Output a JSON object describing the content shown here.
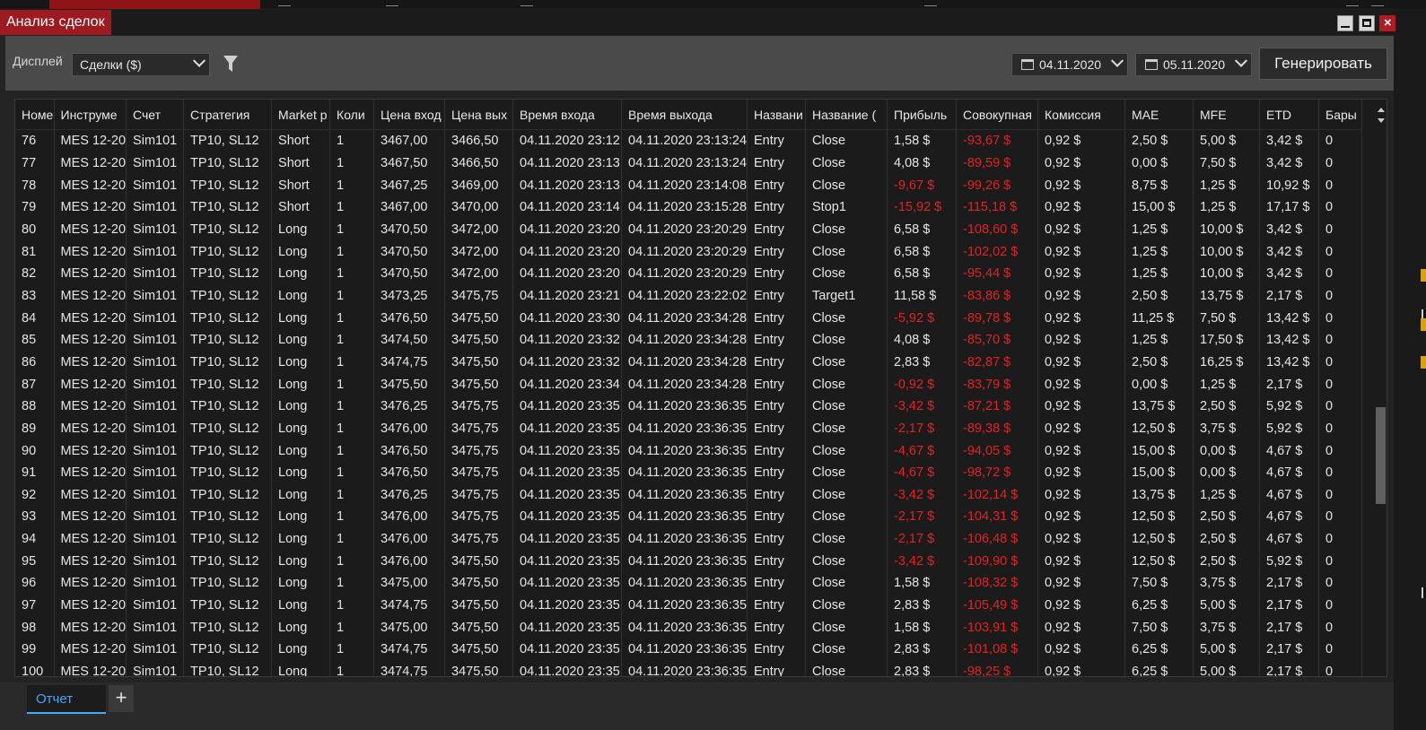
{
  "window": {
    "title": "Анализ сделок"
  },
  "toolbar": {
    "display_label": "Дисплей",
    "display_value": "Сделки ($)",
    "date_from": "04.11.2020",
    "date_to": "05.11.2020",
    "generate_label": "Генерировать"
  },
  "table": {
    "columns": [
      "Номе",
      "Инструме",
      "Счет",
      "Стратегия",
      "Market p",
      "Коли",
      "Цена вход",
      "Цена вых",
      "Время входа",
      "Время выхода",
      "Названи",
      "Название (",
      "Прибыль",
      "Совокупная",
      "Комиссия",
      "MAE",
      "MFE",
      "ETD",
      "Бары"
    ],
    "rows": [
      [
        "76",
        "MES 12-20",
        "Sim101",
        "TP10, SL12",
        "Short",
        "1",
        "3467,00",
        "3466,50",
        "04.11.2020 23:12",
        "04.11.2020 23:13:24",
        "Entry",
        "Close",
        "1,58 $",
        "-93,67 $",
        "0,92 $",
        "2,50 $",
        "5,00 $",
        "3,42 $",
        "0"
      ],
      [
        "77",
        "MES 12-20",
        "Sim101",
        "TP10, SL12",
        "Short",
        "1",
        "3467,50",
        "3466,50",
        "04.11.2020 23:13",
        "04.11.2020 23:13:24",
        "Entry",
        "Close",
        "4,08 $",
        "-89,59 $",
        "0,92 $",
        "0,00 $",
        "7,50 $",
        "3,42 $",
        "0"
      ],
      [
        "78",
        "MES 12-20",
        "Sim101",
        "TP10, SL12",
        "Short",
        "1",
        "3467,25",
        "3469,00",
        "04.11.2020 23:13",
        "04.11.2020 23:14:08",
        "Entry",
        "Close",
        "-9,67 $",
        "-99,26 $",
        "0,92 $",
        "8,75 $",
        "1,25 $",
        "10,92 $",
        "0"
      ],
      [
        "79",
        "MES 12-20",
        "Sim101",
        "TP10, SL12",
        "Short",
        "1",
        "3467,00",
        "3470,00",
        "04.11.2020 23:14",
        "04.11.2020 23:15:28",
        "Entry",
        "Stop1",
        "-15,92 $",
        "-115,18 $",
        "0,92 $",
        "15,00 $",
        "1,25 $",
        "17,17 $",
        "0"
      ],
      [
        "80",
        "MES 12-20",
        "Sim101",
        "TP10, SL12",
        "Long",
        "1",
        "3470,50",
        "3472,00",
        "04.11.2020 23:20",
        "04.11.2020 23:20:29",
        "Entry",
        "Close",
        "6,58 $",
        "-108,60 $",
        "0,92 $",
        "1,25 $",
        "10,00 $",
        "3,42 $",
        "0"
      ],
      [
        "81",
        "MES 12-20",
        "Sim101",
        "TP10, SL12",
        "Long",
        "1",
        "3470,50",
        "3472,00",
        "04.11.2020 23:20",
        "04.11.2020 23:20:29",
        "Entry",
        "Close",
        "6,58 $",
        "-102,02 $",
        "0,92 $",
        "1,25 $",
        "10,00 $",
        "3,42 $",
        "0"
      ],
      [
        "82",
        "MES 12-20",
        "Sim101",
        "TP10, SL12",
        "Long",
        "1",
        "3470,50",
        "3472,00",
        "04.11.2020 23:20",
        "04.11.2020 23:20:29",
        "Entry",
        "Close",
        "6,58 $",
        "-95,44 $",
        "0,92 $",
        "1,25 $",
        "10,00 $",
        "3,42 $",
        "0"
      ],
      [
        "83",
        "MES 12-20",
        "Sim101",
        "TP10, SL12",
        "Long",
        "1",
        "3473,25",
        "3475,75",
        "04.11.2020 23:21",
        "04.11.2020 23:22:02",
        "Entry",
        "Target1",
        "11,58 $",
        "-83,86 $",
        "0,92 $",
        "2,50 $",
        "13,75 $",
        "2,17 $",
        "0"
      ],
      [
        "84",
        "MES 12-20",
        "Sim101",
        "TP10, SL12",
        "Long",
        "1",
        "3476,50",
        "3475,50",
        "04.11.2020 23:30",
        "04.11.2020 23:34:28",
        "Entry",
        "Close",
        "-5,92 $",
        "-89,78 $",
        "0,92 $",
        "11,25 $",
        "7,50 $",
        "13,42 $",
        "0"
      ],
      [
        "85",
        "MES 12-20",
        "Sim101",
        "TP10, SL12",
        "Long",
        "1",
        "3474,50",
        "3475,50",
        "04.11.2020 23:32",
        "04.11.2020 23:34:28",
        "Entry",
        "Close",
        "4,08 $",
        "-85,70 $",
        "0,92 $",
        "1,25 $",
        "17,50 $",
        "13,42 $",
        "0"
      ],
      [
        "86",
        "MES 12-20",
        "Sim101",
        "TP10, SL12",
        "Long",
        "1",
        "3474,75",
        "3475,50",
        "04.11.2020 23:32",
        "04.11.2020 23:34:28",
        "Entry",
        "Close",
        "2,83 $",
        "-82,87 $",
        "0,92 $",
        "2,50 $",
        "16,25 $",
        "13,42 $",
        "0"
      ],
      [
        "87",
        "MES 12-20",
        "Sim101",
        "TP10, SL12",
        "Long",
        "1",
        "3475,50",
        "3475,50",
        "04.11.2020 23:34",
        "04.11.2020 23:34:28",
        "Entry",
        "Close",
        "-0,92 $",
        "-83,79 $",
        "0,92 $",
        "0,00 $",
        "1,25 $",
        "2,17 $",
        "0"
      ],
      [
        "88",
        "MES 12-20",
        "Sim101",
        "TP10, SL12",
        "Long",
        "1",
        "3476,25",
        "3475,75",
        "04.11.2020 23:35",
        "04.11.2020 23:36:35",
        "Entry",
        "Close",
        "-3,42 $",
        "-87,21 $",
        "0,92 $",
        "13,75 $",
        "2,50 $",
        "5,92 $",
        "0"
      ],
      [
        "89",
        "MES 12-20",
        "Sim101",
        "TP10, SL12",
        "Long",
        "1",
        "3476,00",
        "3475,75",
        "04.11.2020 23:35",
        "04.11.2020 23:36:35",
        "Entry",
        "Close",
        "-2,17 $",
        "-89,38 $",
        "0,92 $",
        "12,50 $",
        "3,75 $",
        "5,92 $",
        "0"
      ],
      [
        "90",
        "MES 12-20",
        "Sim101",
        "TP10, SL12",
        "Long",
        "1",
        "3476,50",
        "3475,75",
        "04.11.2020 23:35",
        "04.11.2020 23:36:35",
        "Entry",
        "Close",
        "-4,67 $",
        "-94,05 $",
        "0,92 $",
        "15,00 $",
        "0,00 $",
        "4,67 $",
        "0"
      ],
      [
        "91",
        "MES 12-20",
        "Sim101",
        "TP10, SL12",
        "Long",
        "1",
        "3476,50",
        "3475,75",
        "04.11.2020 23:35",
        "04.11.2020 23:36:35",
        "Entry",
        "Close",
        "-4,67 $",
        "-98,72 $",
        "0,92 $",
        "15,00 $",
        "0,00 $",
        "4,67 $",
        "0"
      ],
      [
        "92",
        "MES 12-20",
        "Sim101",
        "TP10, SL12",
        "Long",
        "1",
        "3476,25",
        "3475,75",
        "04.11.2020 23:35",
        "04.11.2020 23:36:35",
        "Entry",
        "Close",
        "-3,42 $",
        "-102,14 $",
        "0,92 $",
        "13,75 $",
        "1,25 $",
        "4,67 $",
        "0"
      ],
      [
        "93",
        "MES 12-20",
        "Sim101",
        "TP10, SL12",
        "Long",
        "1",
        "3476,00",
        "3475,75",
        "04.11.2020 23:35",
        "04.11.2020 23:36:35",
        "Entry",
        "Close",
        "-2,17 $",
        "-104,31 $",
        "0,92 $",
        "12,50 $",
        "2,50 $",
        "4,67 $",
        "0"
      ],
      [
        "94",
        "MES 12-20",
        "Sim101",
        "TP10, SL12",
        "Long",
        "1",
        "3476,00",
        "3475,75",
        "04.11.2020 23:35",
        "04.11.2020 23:36:35",
        "Entry",
        "Close",
        "-2,17 $",
        "-106,48 $",
        "0,92 $",
        "12,50 $",
        "2,50 $",
        "4,67 $",
        "0"
      ],
      [
        "95",
        "MES 12-20",
        "Sim101",
        "TP10, SL12",
        "Long",
        "1",
        "3476,00",
        "3475,50",
        "04.11.2020 23:35",
        "04.11.2020 23:36:35",
        "Entry",
        "Close",
        "-3,42 $",
        "-109,90 $",
        "0,92 $",
        "12,50 $",
        "2,50 $",
        "5,92 $",
        "0"
      ],
      [
        "96",
        "MES 12-20",
        "Sim101",
        "TP10, SL12",
        "Long",
        "1",
        "3475,00",
        "3475,50",
        "04.11.2020 23:35",
        "04.11.2020 23:36:35",
        "Entry",
        "Close",
        "1,58 $",
        "-108,32 $",
        "0,92 $",
        "7,50 $",
        "3,75 $",
        "2,17 $",
        "0"
      ],
      [
        "97",
        "MES 12-20",
        "Sim101",
        "TP10, SL12",
        "Long",
        "1",
        "3474,75",
        "3475,50",
        "04.11.2020 23:35",
        "04.11.2020 23:36:35",
        "Entry",
        "Close",
        "2,83 $",
        "-105,49 $",
        "0,92 $",
        "6,25 $",
        "5,00 $",
        "2,17 $",
        "0"
      ],
      [
        "98",
        "MES 12-20",
        "Sim101",
        "TP10, SL12",
        "Long",
        "1",
        "3475,00",
        "3475,50",
        "04.11.2020 23:35",
        "04.11.2020 23:36:35",
        "Entry",
        "Close",
        "1,58 $",
        "-103,91 $",
        "0,92 $",
        "7,50 $",
        "3,75 $",
        "2,17 $",
        "0"
      ],
      [
        "99",
        "MES 12-20",
        "Sim101",
        "TP10, SL12",
        "Long",
        "1",
        "3474,75",
        "3475,50",
        "04.11.2020 23:35",
        "04.11.2020 23:36:35",
        "Entry",
        "Close",
        "2,83 $",
        "-101,08 $",
        "0,92 $",
        "6,25 $",
        "5,00 $",
        "2,17 $",
        "0"
      ],
      [
        "100",
        "MES 12-20",
        "Sim101",
        "TP10, SL12",
        "Long",
        "1",
        "3474,75",
        "3475,50",
        "04.11.2020 23:35",
        "04.11.2020 23:36:35",
        "Entry",
        "Close",
        "2,83 $",
        "-98,25 $",
        "0,92 $",
        "6,25 $",
        "5,00 $",
        "2,17 $",
        "0"
      ]
    ]
  },
  "tabs": {
    "active_label": "Отчет",
    "add_label": "+"
  },
  "colors": {
    "title_bg": "#9d1b20",
    "negative": "#e32222",
    "active_tab": "#4aa3ff"
  },
  "icons": [
    "filter-icon",
    "calendar-icon",
    "minimize-icon",
    "maximize-icon",
    "close-icon",
    "chevron-down-icon"
  ]
}
